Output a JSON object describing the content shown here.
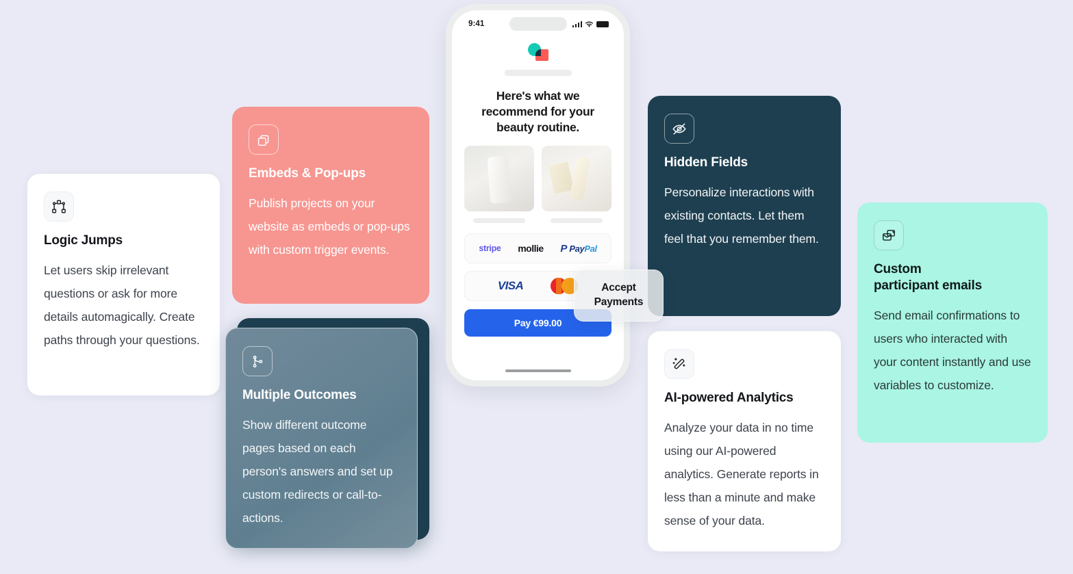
{
  "background_color": "#e9eaf5",
  "cards": [
    {
      "id": "logic-jumps",
      "icon": "node-path-icon",
      "title": "Logic Jumps",
      "body": "Let users skip irrelevant questions or ask for more details automagically. Create paths through your questions.",
      "theme": "light",
      "color": "#ffffff"
    },
    {
      "id": "embeds-popups",
      "icon": "copy-stack-icon",
      "title": "Embeds & Pop-ups",
      "body": "Publish projects on your website as embeds or pop-ups with custom trigger events.",
      "theme": "pink",
      "color": "#f79590"
    },
    {
      "id": "multiple-outcomes",
      "icon": "git-branch-icon",
      "title": "Multiple Outcomes",
      "body": "Show different outcome pages based on each person's answers and set up custom redirects or call-to-actions.",
      "theme": "glass-stack",
      "color": "#1e3f50"
    },
    {
      "id": "hidden-fields",
      "icon": "eye-off-icon",
      "title": "Hidden Fields",
      "body": "Personalize interactions with existing contacts. Let them feel that you remember them.",
      "theme": "dark",
      "color": "#1e3f50"
    },
    {
      "id": "ai-powered-analytics",
      "icon": "magic-wand-icon",
      "title": "AI-powered Analytics",
      "body": "Analyze your data in no time using our AI-powered analytics. Generate reports in less than a minute and make sense of your data.",
      "theme": "light",
      "color": "#ffffff"
    },
    {
      "id": "custom-participant-emails",
      "icon": "mail-stack-icon",
      "title_line1": "Custom",
      "title_line2": "participant emails",
      "body": "Send email confirmations to users who interacted with your content instantly and use variables to customize.",
      "theme": "mint",
      "color": "#aaf5e4"
    }
  ],
  "phone": {
    "status": {
      "time": "9:41",
      "signal_icon": "cellular-bars-icon",
      "wifi_icon": "wifi-icon",
      "battery_icon": "battery-full-icon"
    },
    "logo_icon": "brand-logo-icon",
    "headline": "Here's what we recommend for your beauty routine.",
    "products": [
      {
        "alt": "skincare-tube-photo"
      },
      {
        "alt": "serum-and-soap-photo"
      }
    ],
    "payment_providers": [
      {
        "name": "stripe",
        "label": "stripe"
      },
      {
        "name": "mollie",
        "label": "mollie"
      },
      {
        "name": "paypal",
        "label_dark": "Pay",
        "label_light": "Pal"
      }
    ],
    "card_brands": [
      {
        "name": "visa",
        "label": "VISA"
      },
      {
        "name": "mastercard",
        "label": ""
      }
    ],
    "pay_button_label": "Pay €99.00",
    "pay_button_color": "#2563eb",
    "home_indicator": "home-indicator"
  },
  "floating_badge": {
    "line1": "Accept",
    "line2": "Payments"
  }
}
